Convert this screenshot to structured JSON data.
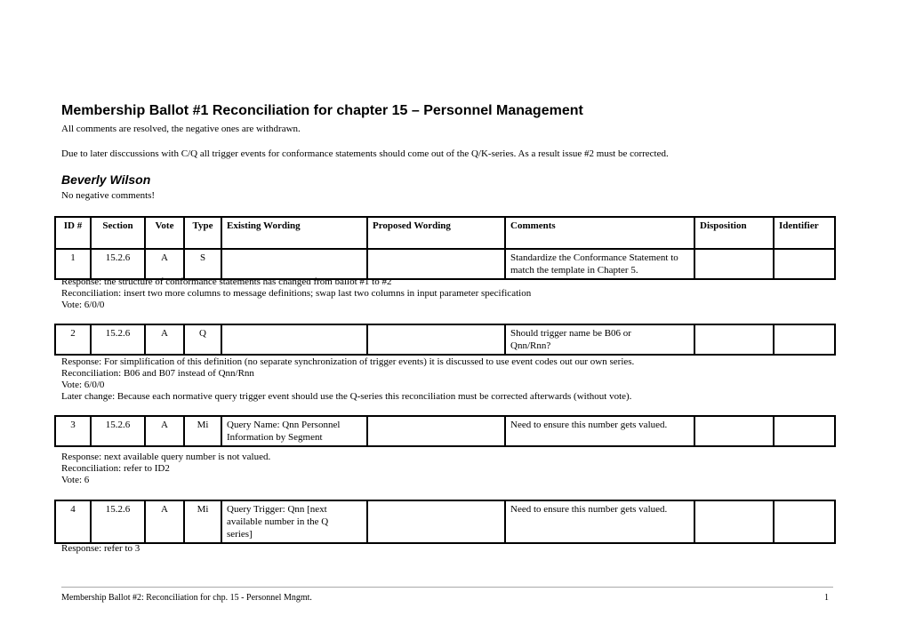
{
  "document": {
    "title": "Membership Ballot #1 Reconciliation for chapter 15 – Personnel Management",
    "intro": "All comments are resolved, the negative ones are withdrawn.",
    "note": "Due to later disccussions with C/Q all trigger events for conformance statements should come out of the Q/K-series. As a result issue #2 must be corrected.",
    "reviewer": "Beverly Wilson",
    "reviewer_note": "No negative comments!"
  },
  "table": {
    "headers": [
      "ID #",
      "Section",
      "Vote",
      "Type",
      "Existing Wording",
      "Proposed Wording",
      "Comments",
      "Disposition",
      "Identifier"
    ]
  },
  "items": [
    {
      "id": "1",
      "section": "15.2.6",
      "vote": "A",
      "type": "S",
      "existing": "",
      "proposed": "",
      "comments": "Standardize the Conformance Statement to match the template in Chapter 5.",
      "disposition": "",
      "identifier": "",
      "notes": [
        "Response: the structure of conformance statements has changed from ballot #1 to #2",
        "Reconciliation: insert two more columns to message definitions; swap last two columns in input parameter specification",
        "Vote: 6/0/0"
      ]
    },
    {
      "id": "2",
      "section": "15.2.6",
      "vote": "A",
      "type": "Q",
      "existing": "",
      "proposed": "",
      "comments": "Should trigger name be B06 or Qnn/Rnn?",
      "disposition": "",
      "identifier": "",
      "notes": [
        "Response: For simplification of this definition (no separate synchronization of trigger events) it is discussed to use event codes out our own series.",
        "Reconciliation: B06 and B07 instead of Qnn/Rnn",
        "Vote: 6/0/0",
        "Later change: Because each normative query trigger event should use the Q-series this reconciliation must be corrected afterwards (without vote)."
      ]
    },
    {
      "id": "3",
      "section": "15.2.6",
      "vote": "A",
      "type": "Mi",
      "existing": "Query Name: Qnn Personnel Information by Segment",
      "proposed": "",
      "comments": "Need to ensure this number gets valued.",
      "disposition": "",
      "identifier": "",
      "notes": [
        "Response: next available query number is not valued.",
        "Reconciliation: refer to ID2",
        "Vote: 6"
      ]
    },
    {
      "id": "4",
      "section": "15.2.6",
      "vote": "A",
      "type": "Mi",
      "existing": "Query Trigger: Qnn [next available number in the Q series]",
      "proposed": "",
      "comments": "Need to ensure this number gets valued.",
      "disposition": "",
      "identifier": "",
      "notes": [
        "Response: refer to 3"
      ]
    }
  ],
  "footer": {
    "text": "Membership Ballot #2: Reconciliation for chp. 15 - Personnel Mngmt.",
    "page": "1"
  }
}
